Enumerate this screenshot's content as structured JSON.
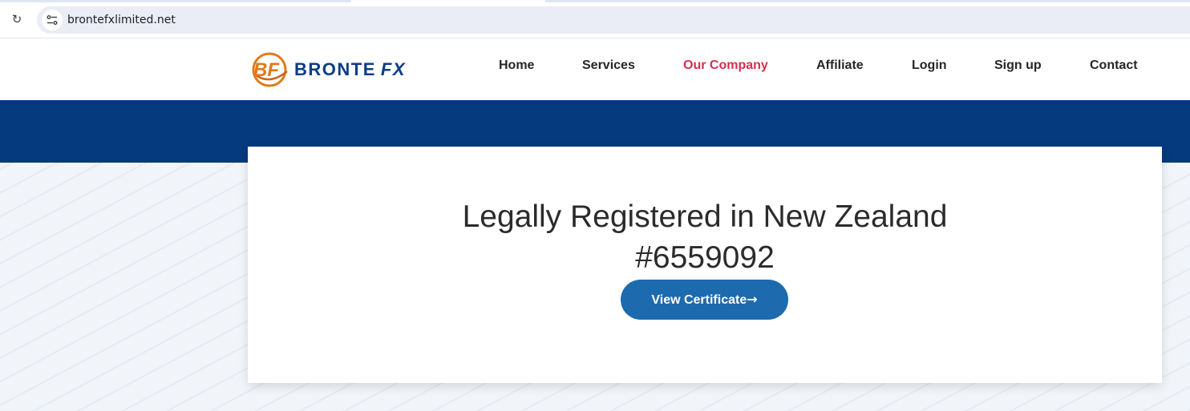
{
  "browser": {
    "url": "brontefxlimited.net",
    "reload_icon": "reload-icon",
    "site_info_icon": "tune-icon"
  },
  "header": {
    "logo": {
      "emblem": "BF",
      "brand": "BRONTE",
      "brand_suffix": "FX"
    },
    "nav": [
      {
        "label": "Home",
        "active": false
      },
      {
        "label": "Services",
        "active": false
      },
      {
        "label": "Our Company",
        "active": true
      },
      {
        "label": "Affiliate",
        "active": false
      },
      {
        "label": "Login",
        "active": false
      },
      {
        "label": "Sign up",
        "active": false
      },
      {
        "label": "Contact",
        "active": false
      }
    ]
  },
  "card": {
    "heading_line1": "Legally Registered in New Zealand",
    "heading_line2": "#6559092",
    "button_label": "View Certificate",
    "button_arrow": "→"
  },
  "colors": {
    "brand_blue": "#063a7e",
    "button_blue": "#1d6aae",
    "active_nav": "#d6304f",
    "logo_orange": "#e07b1a"
  }
}
